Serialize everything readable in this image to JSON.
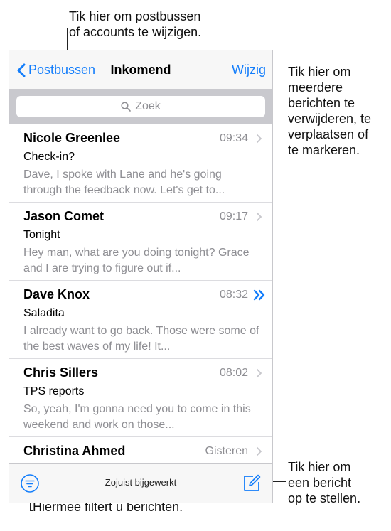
{
  "callouts": {
    "top": "Tik hier om postbussen\nof accounts te wijzigen.",
    "right_edit": "Tik hier om\nmeerdere\nberichten te\nverwijderen, te\nverplaatsen of\nte markeren.",
    "right_compose": "Tik hier om\neen bericht\nop te stellen.",
    "bottom_filter": "Hiermee filtert u berichten."
  },
  "navbar": {
    "back_label": "Postbussen",
    "title": "Inkomend",
    "edit_label": "Wijzig"
  },
  "search": {
    "placeholder": "Zoek"
  },
  "messages": [
    {
      "sender": "Nicole Greenlee",
      "time": "09:34",
      "subject": "Check-in?",
      "preview": "Dave, I spoke with Lane and he's going through the feedback now. Let's get to..."
    },
    {
      "sender": "Jason Comet",
      "time": "09:17",
      "subject": "Tonight",
      "preview": "Hey man, what are you doing tonight? Grace and I are trying to figure out if..."
    },
    {
      "sender": "Dave Knox",
      "time": "08:32",
      "subject": "Saladita",
      "preview": "I already want to go back. Those were some of the best waves of my life! It..."
    },
    {
      "sender": "Chris Sillers",
      "time": "08:02",
      "subject": "TPS reports",
      "preview": "So, yeah, I'm gonna need you to come in this weekend and work on those..."
    },
    {
      "sender": "Christina Ahmed",
      "time": "Gisteren"
    }
  ],
  "toolbar": {
    "status": "Zojuist bijgewerkt"
  },
  "colors": {
    "accent": "#147efb",
    "secondary_text": "#8e8e93",
    "bar_background": "#f7f7f7",
    "search_background": "#c9c9ce"
  },
  "icons": {
    "back": "chevron-left-icon",
    "search": "magnifier-icon",
    "row": "chevron-right-icon",
    "thread": "double-chevron-icon",
    "filter": "filter-icon",
    "compose": "compose-icon"
  }
}
